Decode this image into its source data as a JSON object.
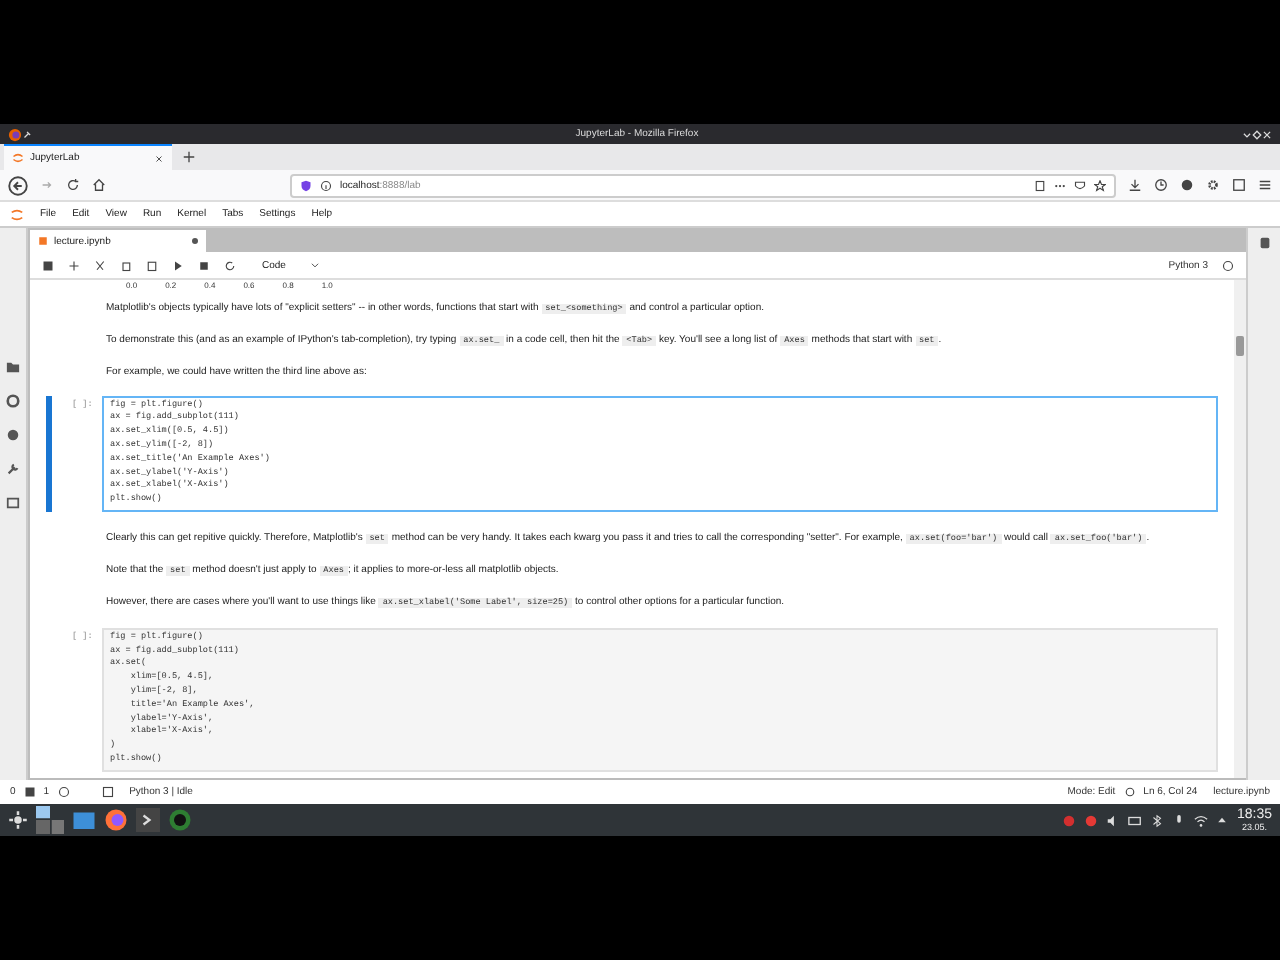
{
  "window": {
    "title": "JupyterLab - Mozilla Firefox"
  },
  "browser_tabs": [
    {
      "label": "JupyterLab",
      "selected": true
    }
  ],
  "address_bar": {
    "host": "localhost",
    "rest": ":8888/lab"
  },
  "menu": [
    "File",
    "Edit",
    "View",
    "Run",
    "Kernel",
    "Tabs",
    "Settings",
    "Help"
  ],
  "notebook_tabs": [
    {
      "label": "lecture.ipynb",
      "selected": true,
      "modified": true
    }
  ],
  "toolbar": {
    "cell_type": "Code",
    "kernel": "Python 3"
  },
  "axis_ticks": [
    "0.0",
    "0.2",
    "0.4",
    "0.6",
    "0.8",
    "1.0"
  ],
  "cells": [
    {
      "kind": "markdown",
      "paragraphs": [
        [
          {
            "kind": "text",
            "text": "Matplotlib's objects typically have lots of \"explicit setters\" -- in other words, functions that start with "
          },
          {
            "kind": "code",
            "text": "set_<something>"
          },
          {
            "kind": "text",
            "text": " and control a particular option."
          }
        ],
        [
          {
            "kind": "text",
            "text": "To demonstrate this (and as an example of IPython's tab-completion), try typing "
          },
          {
            "kind": "code",
            "text": "ax.set_"
          },
          {
            "kind": "text",
            "text": " in a code cell, then hit the "
          },
          {
            "kind": "code",
            "text": "<Tab>"
          },
          {
            "kind": "text",
            "text": " key. You'll see a long list of "
          },
          {
            "kind": "code",
            "text": "Axes"
          },
          {
            "kind": "text",
            "text": " methods that start with "
          },
          {
            "kind": "code",
            "text": "set"
          },
          {
            "kind": "text",
            "text": "."
          }
        ],
        [
          {
            "kind": "text",
            "text": "For example, we could have written the third line above as:"
          }
        ]
      ]
    },
    {
      "kind": "code",
      "prompt": "[ ]:",
      "active": true,
      "lines": [
        "fig = plt.figure()",
        "ax = fig.add_subplot(111)",
        "ax.set_xlim([0.5, 4.5])",
        "ax.set_ylim([-2, 8])",
        "ax.set_title('An Example Axes')",
        "ax.set_ylabel('Y-Axis')",
        "ax.set_xlabel('X-Axis')",
        "plt.show()"
      ]
    },
    {
      "kind": "markdown",
      "paragraphs": [
        [
          {
            "kind": "text",
            "text": "Clearly this can get repitive quickly. Therefore, Matplotlib's "
          },
          {
            "kind": "code",
            "text": "set"
          },
          {
            "kind": "text",
            "text": " method can be very handy. It takes each kwarg you pass it and tries to call the corresponding \"setter\". For example, "
          },
          {
            "kind": "code",
            "text": "ax.set(foo='bar')"
          },
          {
            "kind": "text",
            "text": " would call "
          },
          {
            "kind": "code",
            "text": "ax.set_foo('bar')"
          },
          {
            "kind": "text",
            "text": "."
          }
        ],
        [
          {
            "kind": "text",
            "text": "Note that the "
          },
          {
            "kind": "code",
            "text": "set"
          },
          {
            "kind": "text",
            "text": " method doesn't just apply to "
          },
          {
            "kind": "code",
            "text": "Axes"
          },
          {
            "kind": "text",
            "text": "; it applies to more-or-less all matplotlib objects."
          }
        ],
        [
          {
            "kind": "text",
            "text": "However, there are cases where you'll want to use things like "
          },
          {
            "kind": "code",
            "text": "ax.set_xlabel('Some Label', size=25)"
          },
          {
            "kind": "text",
            "text": " to control other options for a particular function."
          }
        ]
      ]
    },
    {
      "kind": "code",
      "prompt": "[ ]:",
      "active": false,
      "lines": [
        "fig = plt.figure()",
        "ax = fig.add_subplot(111)",
        "ax.set(",
        "    xlim=[0.5, 4.5],",
        "    ylim=[-2, 8],",
        "    title='An Example Axes',",
        "    ylabel='Y-Axis',",
        "    xlabel='X-Axis',",
        ")",
        "plt.show()"
      ]
    }
  ],
  "status_bar": {
    "counts": [
      "0",
      "1"
    ],
    "kernel": "Python 3 | Idle",
    "mode": "Mode: Edit",
    "position": "Ln 6, Col 24",
    "file": "lecture.ipynb"
  },
  "taskbar": {
    "time": "18:35",
    "date": "23.05."
  }
}
